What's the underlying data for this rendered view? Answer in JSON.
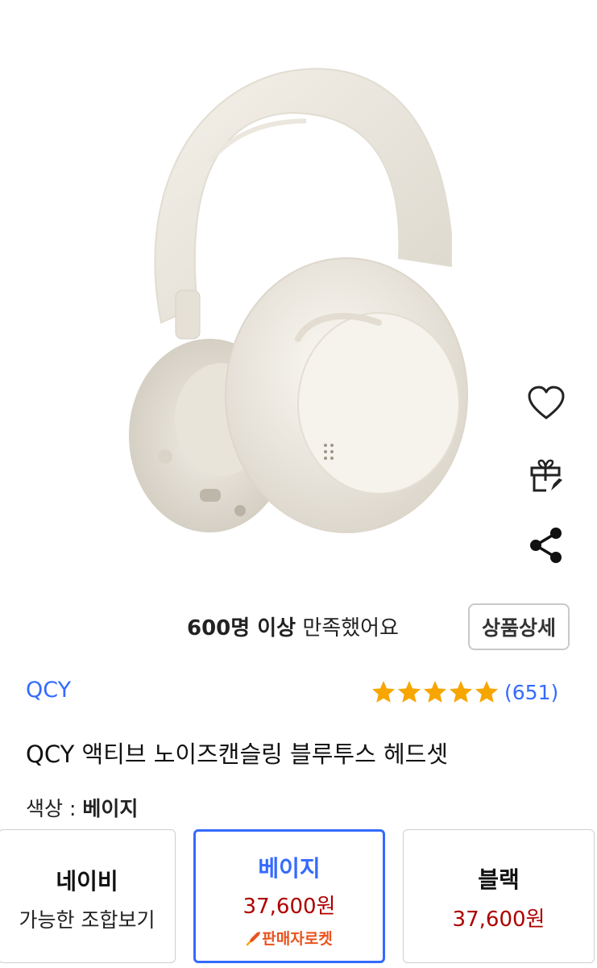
{
  "product": {
    "satisfaction_bold": "600명 이상",
    "satisfaction_rest": " 만족했어요",
    "detail_button": "상품상세",
    "brand": "QCY",
    "rating": 5,
    "review_count": "(651)",
    "title": "QCY 액티브 노이즈캔슬링 블루투스 헤드셋",
    "color_label": "색상 : ",
    "color_value": "베이지"
  },
  "icons": {
    "wishlist": "heart-icon",
    "gift": "gift-icon",
    "share": "share-icon",
    "star": "star-icon",
    "rocket": "rocket-icon"
  },
  "options": [
    {
      "name": "네이비",
      "sub": "가능한 조합보기"
    },
    {
      "name": "베이지",
      "price": "37,600원",
      "badge": "판매자로켓",
      "selected": true
    },
    {
      "name": "블랙",
      "price": "37,600원"
    }
  ],
  "colors": {
    "accent": "#346aff",
    "price": "#ae0000",
    "star": "#f7a600",
    "rocket_badge": "#e9531e"
  }
}
